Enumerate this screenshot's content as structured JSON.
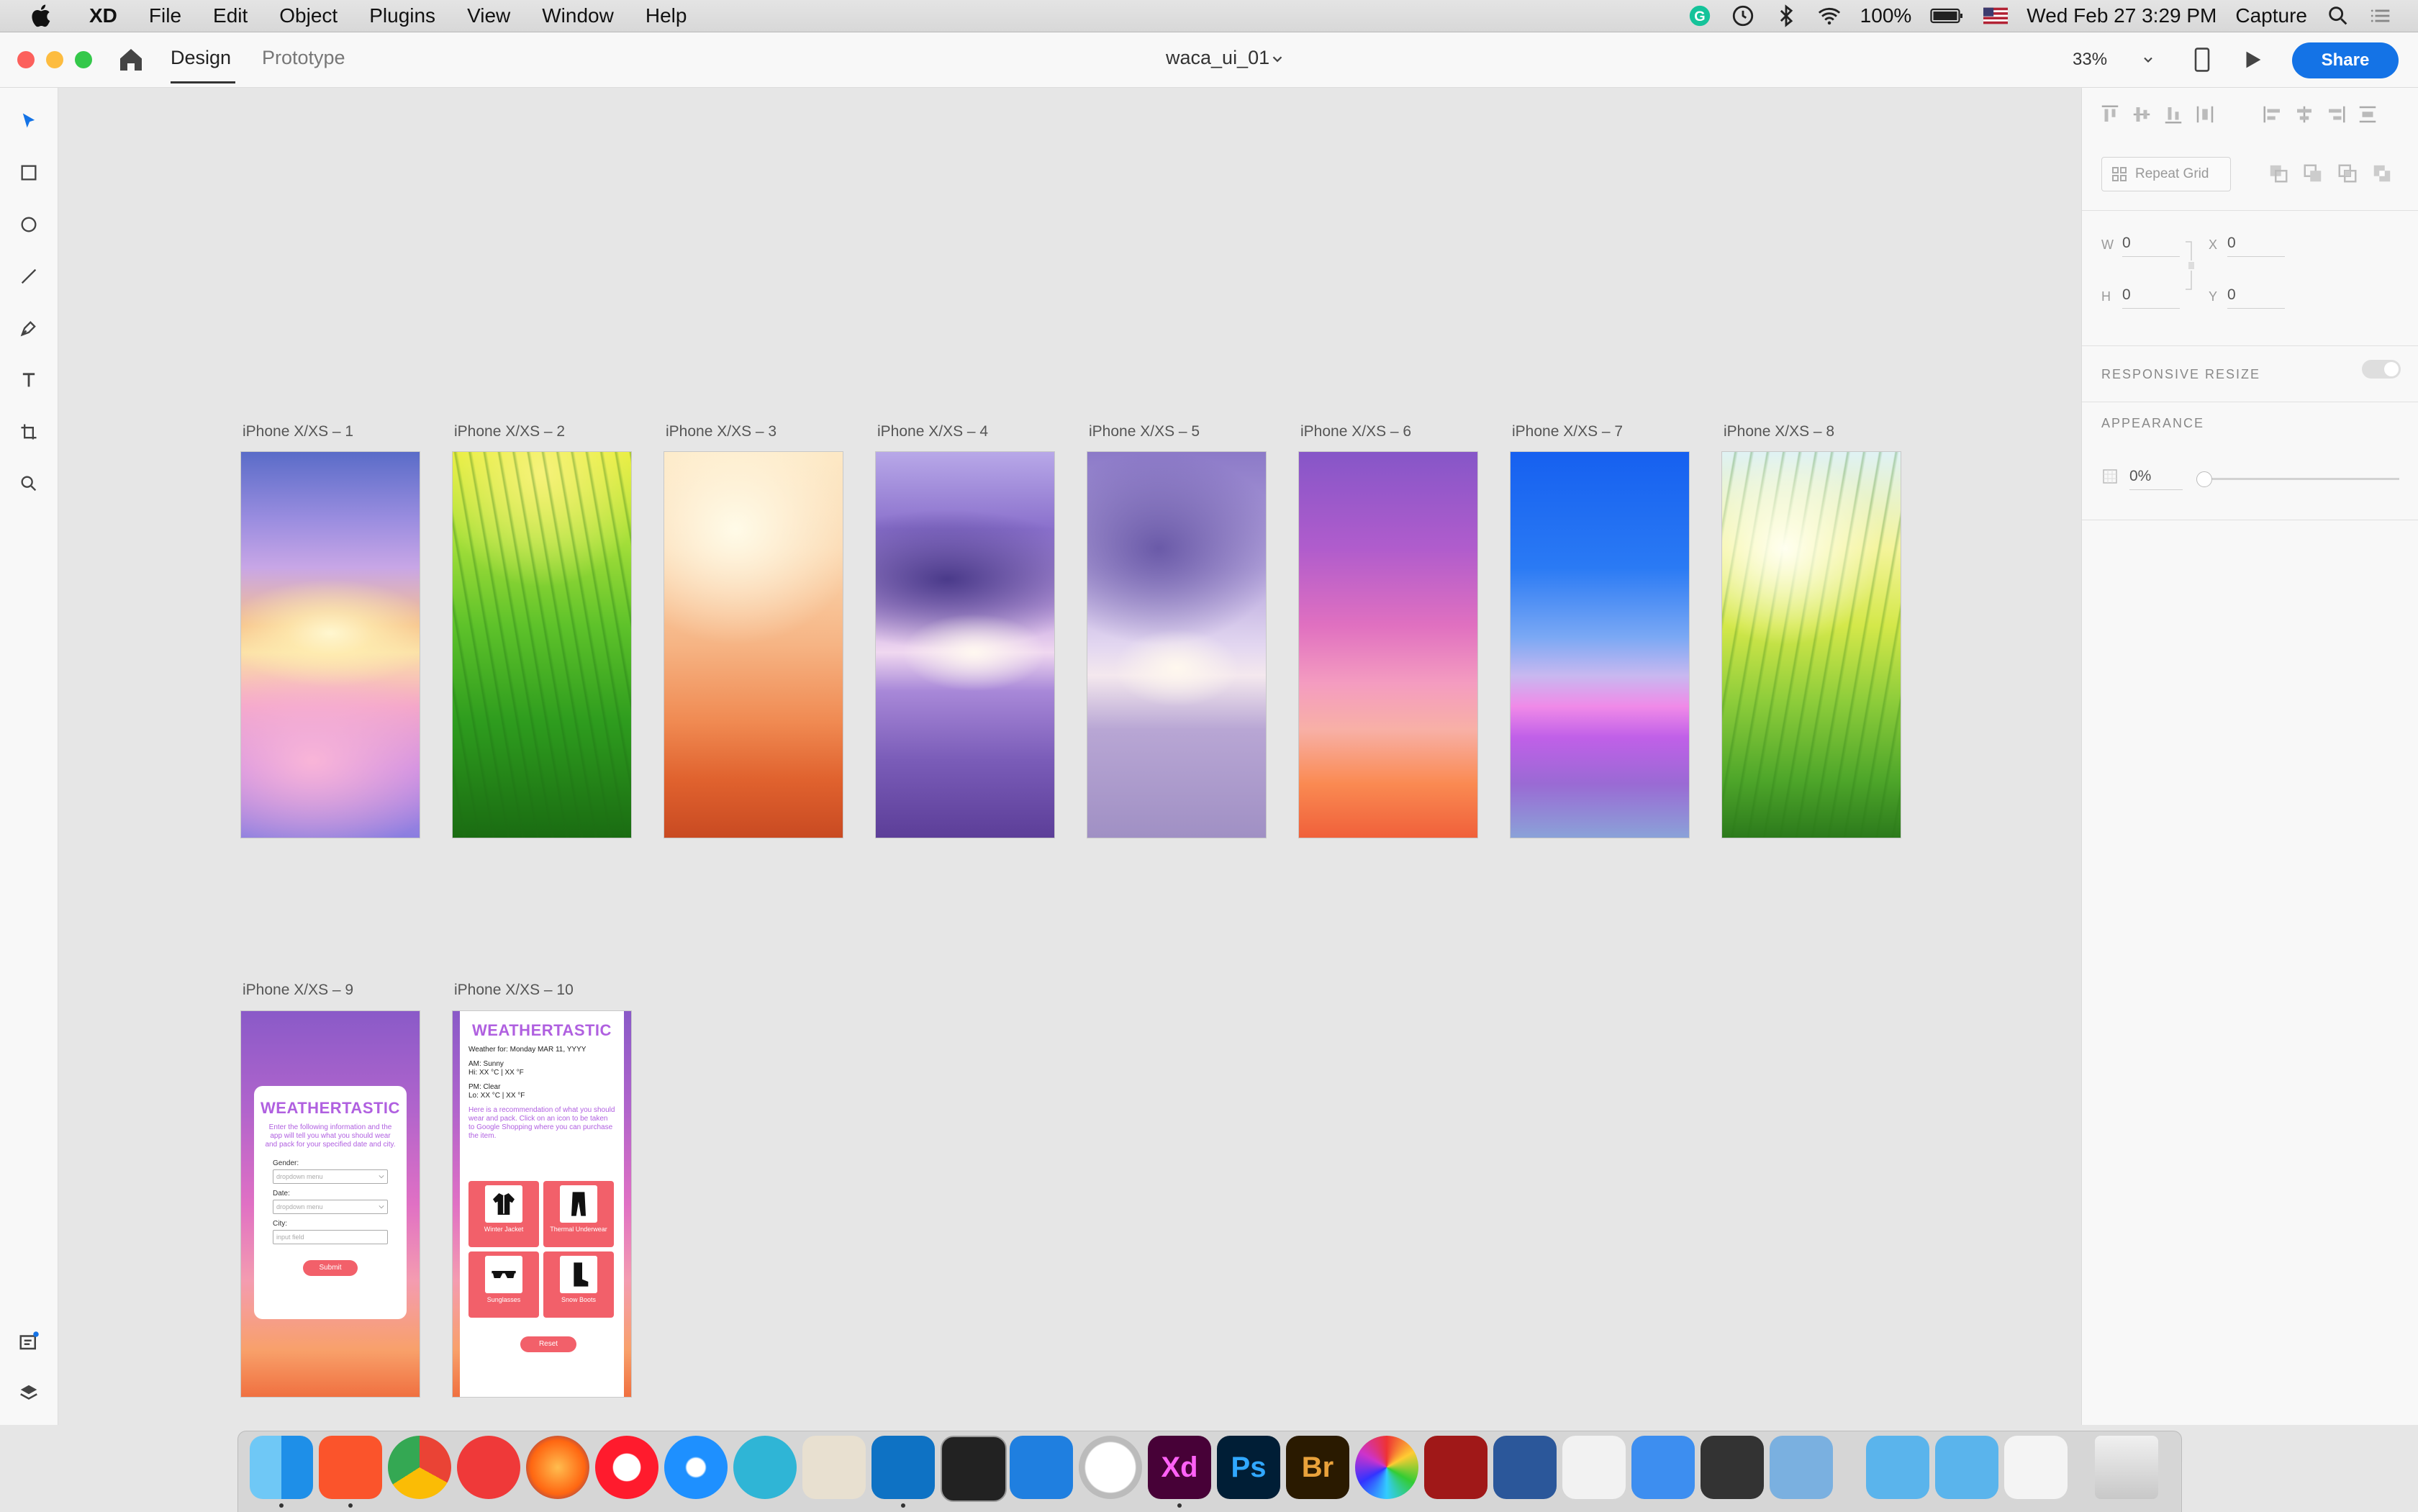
{
  "menubar": {
    "app_name": "XD",
    "menus": [
      "File",
      "Edit",
      "Object",
      "Plugins",
      "View",
      "Window",
      "Help"
    ],
    "battery": "100%",
    "datetime": "Wed Feb 27  3:29 PM",
    "capture": "Capture",
    "icons": [
      "grammarly-icon",
      "clock-icon",
      "bluetooth-icon",
      "wifi-icon",
      "battery-icon",
      "flag-icon",
      "search-icon",
      "list-icon"
    ]
  },
  "titlebar": {
    "tabs": [
      "Design",
      "Prototype"
    ],
    "active_tab": "Design",
    "document_title": "waca_ui_01",
    "zoom": "33%",
    "share_label": "Share"
  },
  "artboards": [
    {
      "label": "iPhone X/XS – 1",
      "theme": "sunset-clouds"
    },
    {
      "label": "iPhone X/XS – 2",
      "theme": "green-grass"
    },
    {
      "label": "iPhone X/XS – 3",
      "theme": "warm-bokeh"
    },
    {
      "label": "iPhone X/XS – 4",
      "theme": "purple-sea"
    },
    {
      "label": "iPhone X/XS – 5",
      "theme": "lavender-sky"
    },
    {
      "label": "iPhone X/XS – 6",
      "theme": "pink-sunset"
    },
    {
      "label": "iPhone X/XS – 7",
      "theme": "blue-horizon"
    },
    {
      "label": "iPhone X/XS – 8",
      "theme": "sunny-grass"
    },
    {
      "label": "iPhone X/XS – 9",
      "theme": "form"
    },
    {
      "label": "iPhone X/XS – 10",
      "theme": "results"
    }
  ],
  "form_screen": {
    "title": "WEATHERTASTIC",
    "intro": "Enter the following information and the app will tell you what you should wear and pack for your specified date and city.",
    "gender_label": "Gender:",
    "gender_value": "dropdown menu",
    "date_label": "Date:",
    "date_value": "dropdown menu",
    "city_label": "City:",
    "city_placeholder": "input field",
    "submit_label": "Submit"
  },
  "results_screen": {
    "title": "WEATHERTASTIC",
    "weather_for": "Weather for: Monday MAR 11, YYYY",
    "am_line1": "AM: Sunny",
    "am_line2": "Hi: XX °C | XX °F",
    "pm_line1": "PM: Clear",
    "pm_line2": "Lo: XX °C | XX °F",
    "recommendation": "Here is a recommendation of what you should wear and pack. Click on an icon to be taken to Google Shopping where you can purchase the item.",
    "items": [
      {
        "label": "Winter Jacket",
        "icon": "jacket-icon"
      },
      {
        "label": "Thermal Underwear",
        "icon": "thermal-underwear-icon"
      },
      {
        "label": "Sunglasses",
        "icon": "sunglasses-icon"
      },
      {
        "label": "Snow Boots",
        "icon": "boots-icon"
      }
    ],
    "reset_label": "Reset"
  },
  "properties_panel": {
    "repeat_grid_label": "Repeat Grid",
    "w_label": "W",
    "w_value": "0",
    "x_label": "X",
    "x_value": "0",
    "h_label": "H",
    "h_value": "0",
    "y_label": "Y",
    "y_value": "0",
    "responsive_resize": "RESPONSIVE RESIZE",
    "appearance": "APPEARANCE",
    "opacity_value": "0%"
  },
  "colors": {
    "accent": "#1473e6",
    "form_purple": "#b060e0",
    "button_coral": "#f2606a"
  },
  "dock": {
    "apps": [
      "finder-icon",
      "brave-icon",
      "chrome-icon",
      "vivaldi-icon",
      "firefox-icon",
      "opera-icon",
      "safari-icon",
      "markdown-icon",
      "scrivener-icon",
      "vscode-icon",
      "terminal-icon",
      "xcode-icon",
      "clock-app-icon",
      "xd-app-icon",
      "photoshop-icon",
      "bridge-icon",
      "color-icon",
      "photo-booth-icon",
      "word-icon",
      "textedit-icon",
      "keynote-icon",
      "calendar-icon",
      "preview-icon",
      "app-store-folder-icon",
      "downloads-folder-icon",
      "screenshot-icon",
      "trash-icon"
    ],
    "xd_label": "Xd",
    "ps_label": "Ps",
    "br_label": "Br"
  }
}
